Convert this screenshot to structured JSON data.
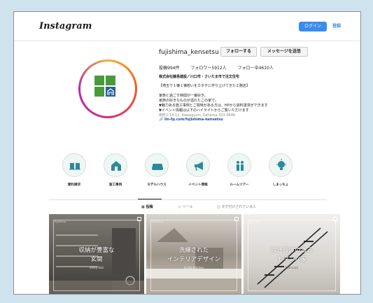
{
  "header": {
    "logo": "Instagram",
    "login_label": "ログイン",
    "signup_label": "登録",
    "colors": {
      "accent": "#3a8bf0"
    }
  },
  "profile": {
    "username": "fujishima_kensetsu",
    "follow_label": "フォローする",
    "message_label": "メッセージを送信",
    "stats": {
      "posts": "投稿994件",
      "followers": "フォロワー5912人",
      "following": "フォロー中4610人"
    },
    "bio": {
      "company": "株式会社藤島建設／川口市・さいたま市で注文住宅",
      "tagline": "【埼玉で１棟１棟想いをカタチに作り上げてきた工務店】",
      "line1": "家族と過ごす時間が一番好き。",
      "line2": "家族の好きなものが溢れたこの家で。",
      "line3": "▼魅力ある施工事例とご興味がある方は、HPから資料請求ができます",
      "line4": "▼イベント情報は以下のハイライトからご覧いただけます",
      "address": "南町2-14-12, Kawaguchi, Saitama 333-0846",
      "link": "lin-fp.com/fujishima-kensetsu"
    },
    "avatar_icon": "house-logo-icon"
  },
  "highlights": [
    {
      "label": "資料請求",
      "icon": "book-icon"
    },
    {
      "label": "施工事例",
      "icon": "house-icon"
    },
    {
      "label": "モデルハウス",
      "icon": "sofa-icon"
    },
    {
      "label": "イベント情報",
      "icon": "megaphone-icon"
    },
    {
      "label": "ルームツアー",
      "icon": "family-icon"
    },
    {
      "label": "しまっちょ",
      "icon": "bulb-icon"
    }
  ],
  "tabs": [
    {
      "label": "投稿",
      "icon": "grid-icon"
    },
    {
      "label": "リール",
      "icon": "reel-icon"
    },
    {
      "label": "タグ付けされている人",
      "icon": "tag-icon"
    }
  ],
  "posts": [
    {
      "caption1": "収納が豊富な",
      "caption2": "玄関",
      "sub": "Entry Hall"
    },
    {
      "caption1": "洗練された",
      "caption2": "インテリアデザイン",
      "sub": "Living Kitchen"
    },
    {
      "caption1": "吹き抜けのある",
      "caption2": "モダンな家",
      "sub": "Staircase"
    }
  ],
  "post_brand": "fujishima"
}
